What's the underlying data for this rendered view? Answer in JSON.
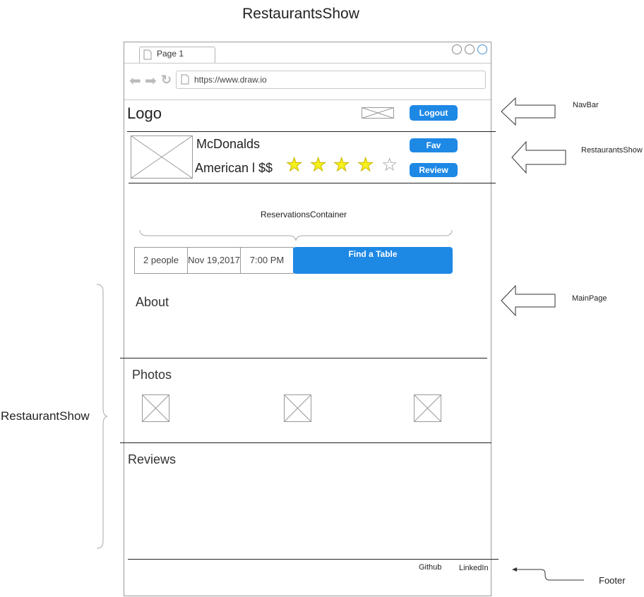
{
  "diagram_title": "RestaurantsShow",
  "browser": {
    "tab_label": "Page 1",
    "url": "https://www.draw.io"
  },
  "navbar": {
    "logo": "Logo",
    "logout_label": "Logout"
  },
  "restaurant": {
    "name": "McDonalds",
    "cuisine_price": "American l $$",
    "rating": 4,
    "rating_max": 5,
    "fav_label": "Fav",
    "review_label": "Review"
  },
  "reservations": {
    "label": "ReservationsContainer",
    "people": "2 people",
    "date": "Nov 19,2017",
    "time": "7:00 PM",
    "find_label": "Find a Table"
  },
  "sections": {
    "about": "About",
    "photos": "Photos",
    "reviews": "Reviews"
  },
  "footer": {
    "github": "Github",
    "linkedin": "LinkedIn"
  },
  "annotations": {
    "navbar": "NavBar",
    "restaurants_show": "RestaurantsShow",
    "main_page": "MainPage",
    "footer": "Footer",
    "restaurant_show": "RestaurantShow"
  },
  "colors": {
    "button_blue": "#1e88e5",
    "star_fill": "#f5f01a"
  }
}
